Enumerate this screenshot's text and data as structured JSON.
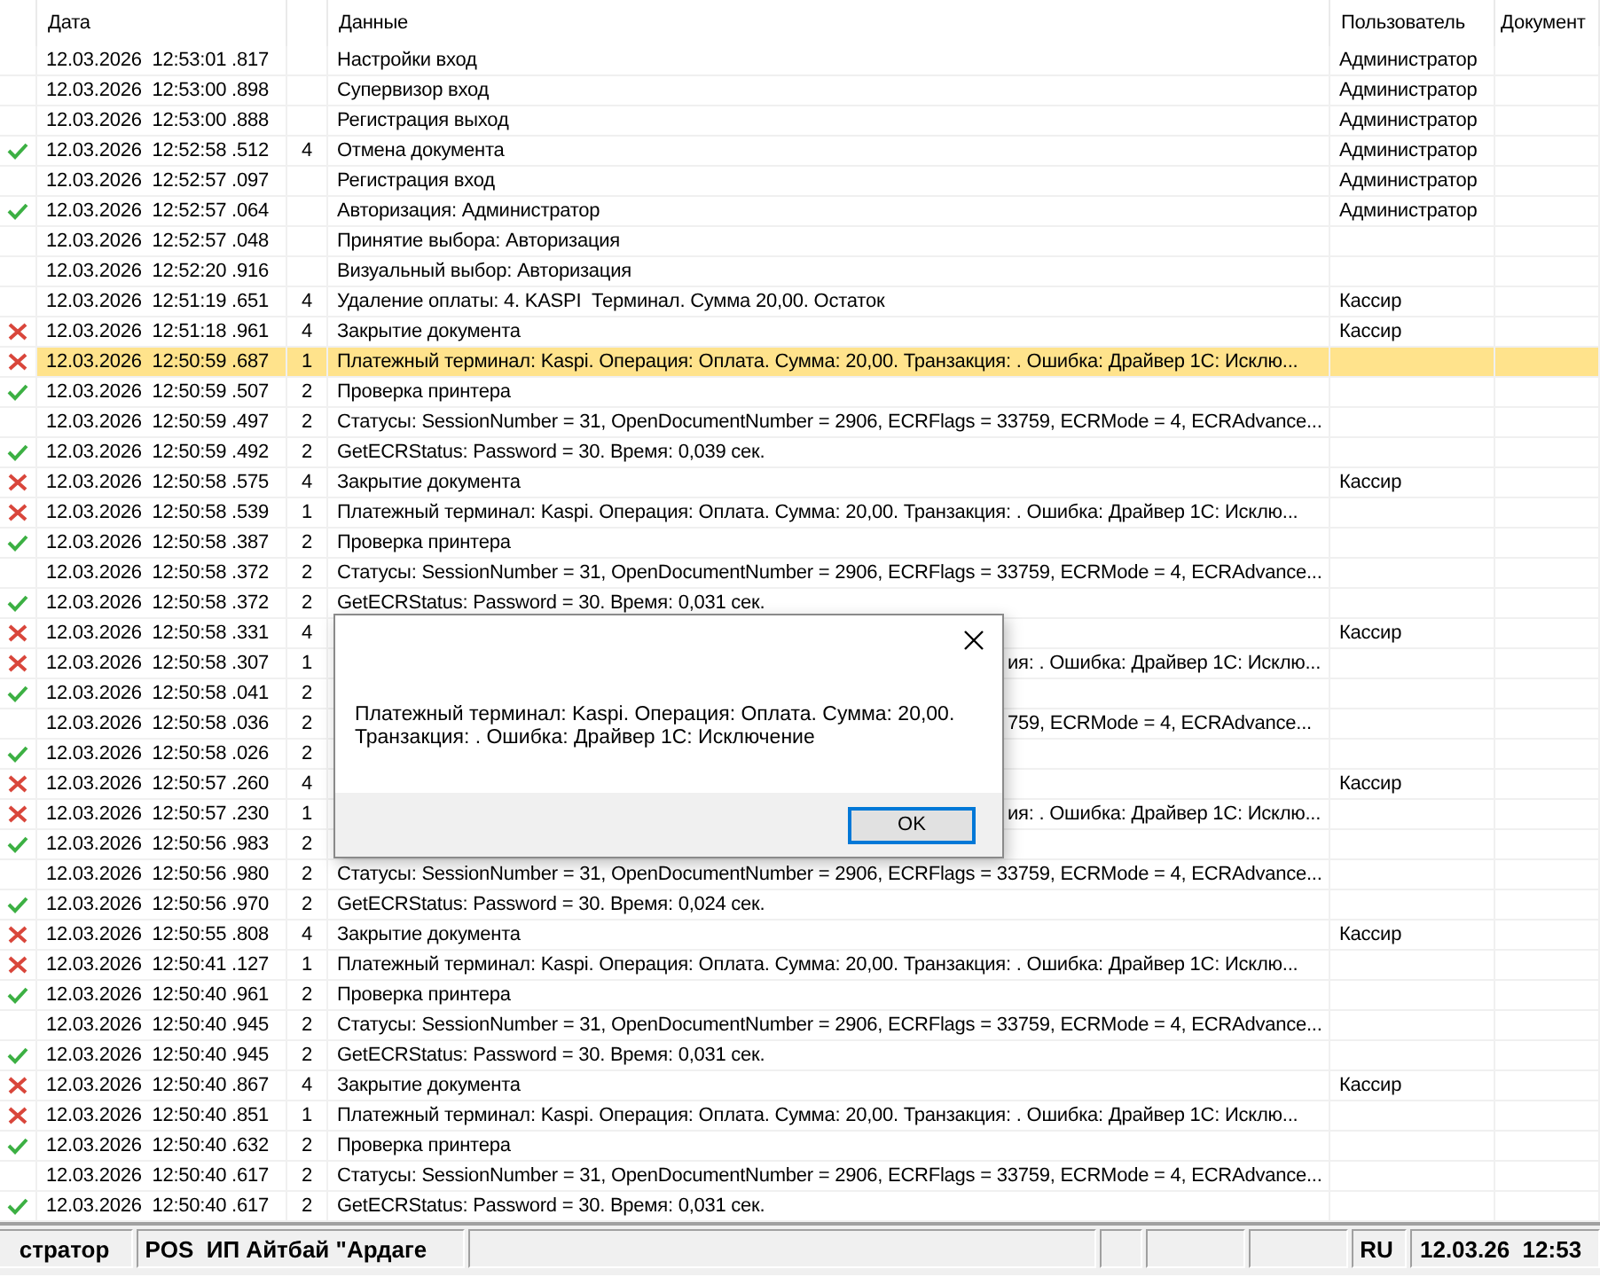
{
  "table": {
    "header": {
      "date": "Дата",
      "data": "Данные",
      "user": "Пользователь",
      "document": "Документ"
    },
    "rows": [
      {
        "kind": "plain",
        "date": "12.03.2026  12:53:01 .817",
        "data": "Настройки вход",
        "user": "Администратор",
        "selected": false
      },
      {
        "kind": "plain",
        "date": "12.03.2026  12:53:00 .898",
        "data": "Супервизор вход",
        "user": "Администратор",
        "selected": false
      },
      {
        "kind": "plain",
        "date": "12.03.2026  12:53:00 .888",
        "data": "Регистрация выход",
        "user": "Администратор",
        "selected": false
      },
      {
        "kind": "success",
        "date": "12.03.2026  12:52:58 .512",
        "level": "4",
        "data": "Отмена документа",
        "user": "Администратор",
        "selected": false
      },
      {
        "kind": "plain",
        "date": "12.03.2026  12:52:57 .097",
        "data": "Регистрация вход",
        "user": "Администратор",
        "selected": false
      },
      {
        "kind": "success",
        "date": "12.03.2026  12:52:57 .064",
        "data": "Авторизация: Администратор",
        "user": "Администратор",
        "selected": false
      },
      {
        "kind": "plain",
        "date": "12.03.2026  12:52:57 .048",
        "data": "Принятие выбора: Авторизация",
        "selected": false
      },
      {
        "kind": "plain",
        "date": "12.03.2026  12:52:20 .916",
        "data": "Визуальный выбор: Авторизация",
        "selected": false
      },
      {
        "kind": "plain",
        "date": "12.03.2026  12:51:19 .651",
        "level": "4",
        "data": "Удаление оплаты: 4. KASPI  Терминал. Сумма 20,00. Остаток",
        "user": "Кассир",
        "selected": false
      },
      {
        "kind": "error",
        "date": "12.03.2026  12:51:18 .961",
        "level": "4",
        "data": "Закрытие документа",
        "user": "Кассир",
        "selected": false
      },
      {
        "kind": "error",
        "date": "12.03.2026  12:50:59 .687",
        "level": "1",
        "data": "Платежный терминал: Kaspi. Операция: Оплата. Сумма: 20,00. Транзакция: . Ошибка: Драйвер 1С: Исклю...",
        "selected": true
      },
      {
        "kind": "success",
        "date": "12.03.2026  12:50:59 .507",
        "level": "2",
        "data": "Проверка принтера",
        "selected": false
      },
      {
        "kind": "plain",
        "date": "12.03.2026  12:50:59 .497",
        "level": "2",
        "data": "Статусы: SessionNumber = 31, OpenDocumentNumber = 2906, ECRFlags = 33759, ECRMode = 4, ECRAdvance...",
        "selected": false
      },
      {
        "kind": "success",
        "date": "12.03.2026  12:50:59 .492",
        "level": "2",
        "data": "GetECRStatus: Password = 30. Время: 0,039 сек.",
        "selected": false
      },
      {
        "kind": "error",
        "date": "12.03.2026  12:50:58 .575",
        "level": "4",
        "data": "Закрытие документа",
        "user": "Кассир",
        "selected": false
      },
      {
        "kind": "error",
        "date": "12.03.2026  12:50:58 .539",
        "level": "1",
        "data": "Платежный терминал: Kaspi. Операция: Оплата. Сумма: 20,00. Транзакция: . Ошибка: Драйвер 1С: Исклю...",
        "selected": false
      },
      {
        "kind": "success",
        "date": "12.03.2026  12:50:58 .387",
        "level": "2",
        "data": "Проверка принтера",
        "selected": false
      },
      {
        "kind": "plain",
        "date": "12.03.2026  12:50:58 .372",
        "level": "2",
        "data": "Статусы: SessionNumber = 31, OpenDocumentNumber = 2906, ECRFlags = 33759, ECRMode = 4, ECRAdvance...",
        "selected": false
      },
      {
        "kind": "success",
        "date": "12.03.2026  12:50:58 .372",
        "level": "2",
        "data": "GetECRStatus: Password = 30. Время: 0,031 сек.",
        "selected": false
      },
      {
        "kind": "error",
        "date": "12.03.2026  12:50:58 .331",
        "level": "4",
        "user": "Кассир",
        "selected": false
      },
      {
        "kind": "error",
        "date": "12.03.2026  12:50:58 .307",
        "level": "1",
        "data_tail": "ия: . Ошибка: Драйвер 1С: Исклю...",
        "selected": false
      },
      {
        "kind": "success",
        "date": "12.03.2026  12:50:58 .041",
        "level": "2",
        "selected": false
      },
      {
        "kind": "plain",
        "date": "12.03.2026  12:50:58 .036",
        "level": "2",
        "data_tail": "759, ECRMode = 4, ECRAdvance...",
        "selected": false
      },
      {
        "kind": "success",
        "date": "12.03.2026  12:50:58 .026",
        "level": "2",
        "selected": false
      },
      {
        "kind": "error",
        "date": "12.03.2026  12:50:57 .260",
        "level": "4",
        "user": "Кассир",
        "selected": false
      },
      {
        "kind": "error",
        "date": "12.03.2026  12:50:57 .230",
        "level": "1",
        "data_tail": "ия: . Ошибка: Драйвер 1С: Исклю...",
        "selected": false
      },
      {
        "kind": "success",
        "date": "12.03.2026  12:50:56 .983",
        "level": "2",
        "selected": false
      },
      {
        "kind": "plain",
        "date": "12.03.2026  12:50:56 .980",
        "level": "2",
        "data": "Статусы: SessionNumber = 31, OpenDocumentNumber = 2906, ECRFlags = 33759, ECRMode = 4, ECRAdvance...",
        "selected": false
      },
      {
        "kind": "success",
        "date": "12.03.2026  12:50:56 .970",
        "level": "2",
        "data": "GetECRStatus: Password = 30. Время: 0,024 сек.",
        "selected": false
      },
      {
        "kind": "error",
        "date": "12.03.2026  12:50:55 .808",
        "level": "4",
        "data": "Закрытие документа",
        "user": "Кассир",
        "selected": false
      },
      {
        "kind": "error",
        "date": "12.03.2026  12:50:41 .127",
        "level": "1",
        "data": "Платежный терминал: Kaspi. Операция: Оплата. Сумма: 20,00. Транзакция: . Ошибка: Драйвер 1С: Исклю...",
        "selected": false
      },
      {
        "kind": "success",
        "date": "12.03.2026  12:50:40 .961",
        "level": "2",
        "data": "Проверка принтера",
        "selected": false
      },
      {
        "kind": "plain",
        "date": "12.03.2026  12:50:40 .945",
        "level": "2",
        "data": "Статусы: SessionNumber = 31, OpenDocumentNumber = 2906, ECRFlags = 33759, ECRMode = 4, ECRAdvance...",
        "selected": false
      },
      {
        "kind": "success",
        "date": "12.03.2026  12:50:40 .945",
        "level": "2",
        "data": "GetECRStatus: Password = 30. Время: 0,031 сек.",
        "selected": false
      },
      {
        "kind": "error",
        "date": "12.03.2026  12:50:40 .867",
        "level": "4",
        "data": "Закрытие документа",
        "user": "Кассир",
        "selected": false
      },
      {
        "kind": "error",
        "date": "12.03.2026  12:50:40 .851",
        "level": "1",
        "data": "Платежный терминал: Kaspi. Операция: Оплата. Сумма: 20,00. Транзакция: . Ошибка: Драйвер 1С: Исклю...",
        "selected": false
      },
      {
        "kind": "success",
        "date": "12.03.2026  12:50:40 .632",
        "level": "2",
        "data": "Проверка принтера",
        "selected": false
      },
      {
        "kind": "plain",
        "date": "12.03.2026  12:50:40 .617",
        "level": "2",
        "data": "Статусы: SessionNumber = 31, OpenDocumentNumber = 2906, ECRFlags = 33759, ECRMode = 4, ECRAdvance...",
        "selected": false
      },
      {
        "kind": "success",
        "date": "12.03.2026  12:50:40 .617",
        "level": "2",
        "data": "GetECRStatus: Password = 30. Время: 0,031 сек.",
        "selected": false
      }
    ]
  },
  "dialog": {
    "message": [
      "Платежный терминал: Kaspi. Операция: Оплата. Сумма: 20,00.",
      "Транзакция: . Ошибка: Драйвер 1С: Исключение"
    ],
    "button": "OK"
  },
  "status_bar": {
    "panels": [
      {
        "kind": "text",
        "text": "стратор"
      },
      {
        "kind": "text",
        "text": "POS  ИП Айтбай \"Ардаге"
      },
      {
        "kind": "blank"
      },
      {
        "kind": "blank"
      },
      {
        "kind": "blank"
      },
      {
        "kind": "blank"
      },
      {
        "kind": "text",
        "text": "RU"
      },
      {
        "kind": "text",
        "text": "12.03.26  12:53"
      }
    ]
  }
}
